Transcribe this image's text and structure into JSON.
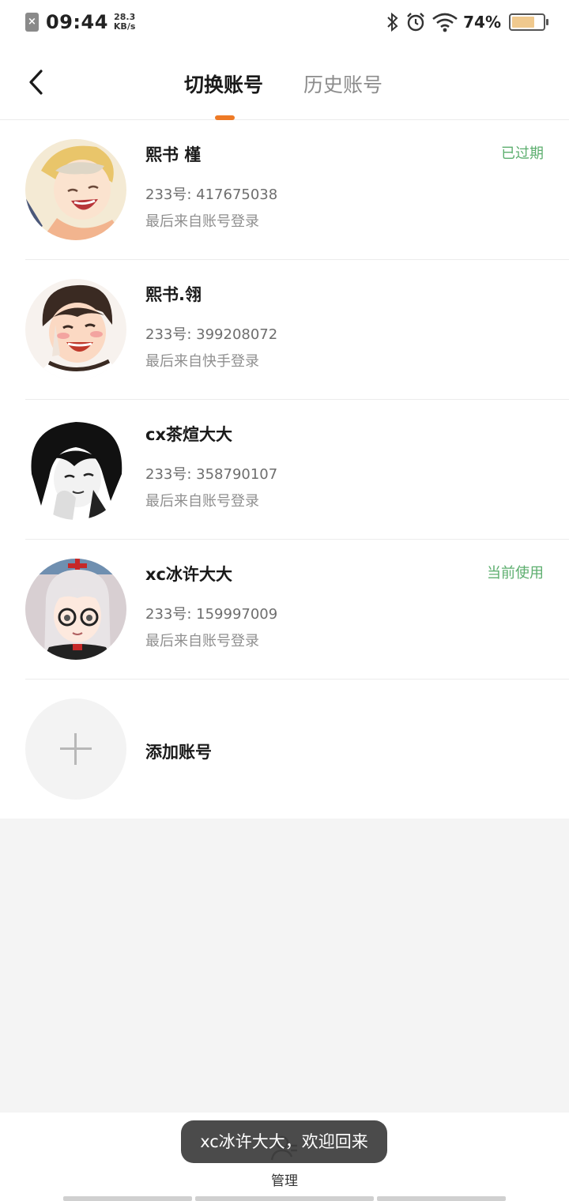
{
  "status_bar": {
    "time": "09:44",
    "speed_value": "28.3",
    "speed_unit": "KB/s",
    "battery_percent": "74%",
    "battery_level": 0.74,
    "battery_color": "#f0c98e"
  },
  "header": {
    "tabs": [
      {
        "label": "切换账号",
        "active": true
      },
      {
        "label": "历史账号",
        "active": false
      }
    ],
    "accent_color": "#ee7a26"
  },
  "accounts": [
    {
      "name": "熙书 槿",
      "id": "233号: 417675038",
      "source": "最后来自账号登录",
      "status": "已过期"
    },
    {
      "name": "熙书.翎",
      "id": "233号: 399208072",
      "source": "最后来自快手登录",
      "status": ""
    },
    {
      "name": "cx茶煊大大",
      "id": "233号: 358790107",
      "source": "最后来自账号登录",
      "status": ""
    },
    {
      "name": "xc冰许大大",
      "id": "233号: 159997009",
      "source": "最后来自账号登录",
      "status": "当前使用"
    }
  ],
  "add_account": {
    "label": "添加账号"
  },
  "bottom": {
    "manage_label": "管理"
  },
  "toast": {
    "text": "xc冰许大大，欢迎回来"
  },
  "status_color": "#5cae6e"
}
